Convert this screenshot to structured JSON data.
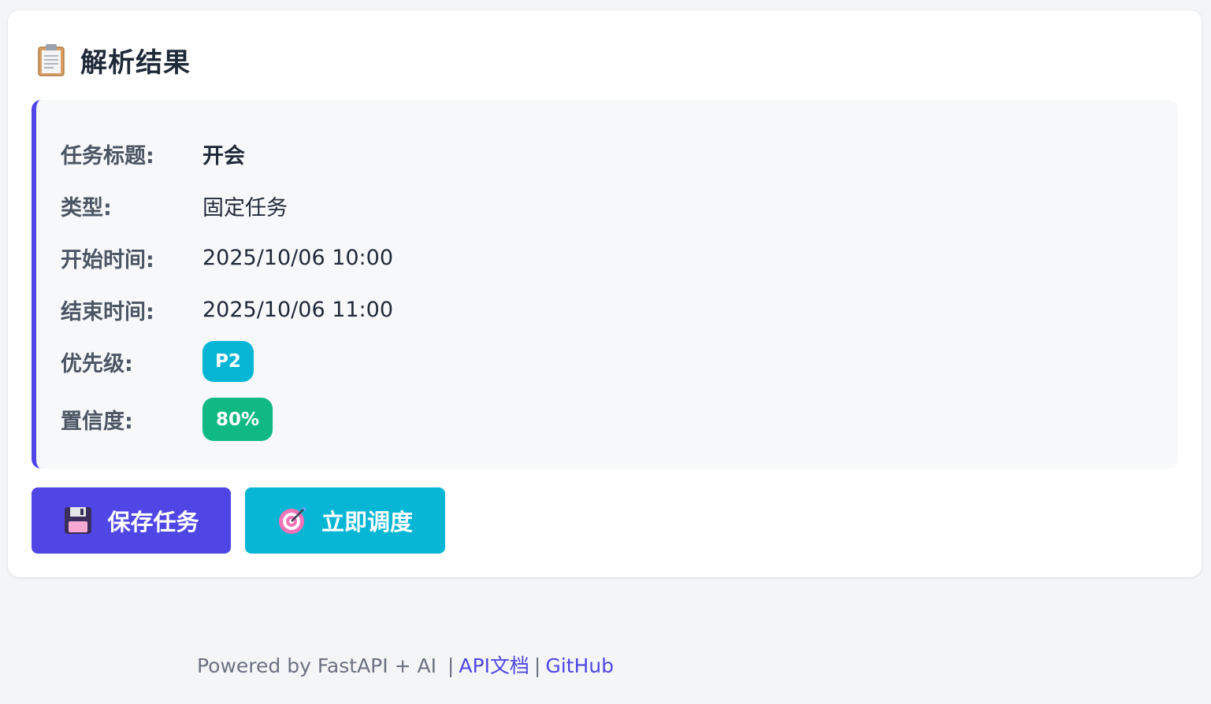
{
  "card": {
    "title": "解析结果",
    "title_icon": "clipboard-icon"
  },
  "result": {
    "fields": [
      {
        "label": "任务标题:",
        "value": "开会"
      },
      {
        "label": "类型:",
        "value": "固定任务"
      },
      {
        "label": "开始时间:",
        "value": "2025/10/06 10:00"
      },
      {
        "label": "结束时间:",
        "value": "2025/10/06 11:00"
      },
      {
        "label": "优先级:",
        "value": "P2"
      },
      {
        "label": "置信度:",
        "value": "80%"
      }
    ],
    "accent_color": "#4f46e5",
    "priority_color": "#06b6d4",
    "confidence_color": "#10b981"
  },
  "actions": {
    "save_label": "保存任务",
    "save_icon": "floppy-disk-icon",
    "dispatch_label": "立即调度",
    "dispatch_icon": "target-icon"
  },
  "footer": {
    "prefix": "Powered by FastAPI + AI",
    "separator": "|",
    "api_docs_link": "API文档",
    "github_link": "GitHub"
  }
}
